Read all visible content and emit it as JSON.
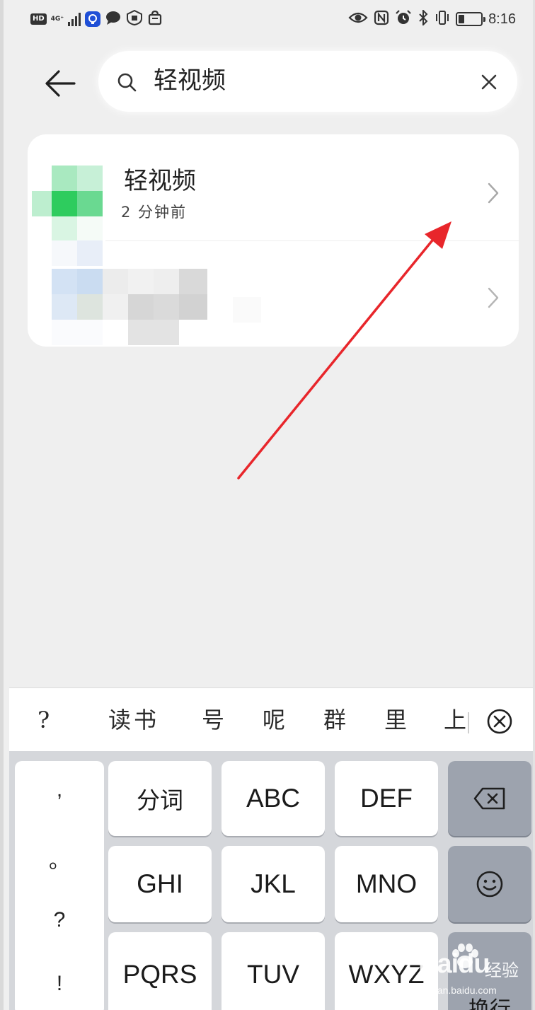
{
  "status_bar": {
    "hd_label": "HD",
    "network_label": "4G⁺",
    "time": "8:16",
    "battery_level_percent": 25,
    "left_icons": [
      "hd-badge-icon",
      "signal-icon",
      "app-notification-icon",
      "chat-icon",
      "shield-icon",
      "bag-icon"
    ],
    "right_icons": [
      "eye-icon",
      "nfc-icon",
      "alarm-icon",
      "bluetooth-icon",
      "vibrate-icon",
      "battery-icon"
    ]
  },
  "search": {
    "query": "轻视频",
    "icons": {
      "back": "back-arrow-icon",
      "search": "search-icon",
      "clear": "close-icon"
    }
  },
  "results": [
    {
      "title": "轻视频",
      "subtitle": "2 分钟前",
      "icon": "app-icon-pixelated",
      "chevron": "chevron-right-icon"
    },
    {
      "title": "",
      "subtitle": "",
      "icon": "app-icon-pixelated",
      "chevron": "chevron-right-icon",
      "blurred": true
    }
  ],
  "candidates": [
    "?",
    "读书",
    "号",
    "呢",
    "群",
    "里",
    "上"
  ],
  "keyboard": {
    "punctuation": [
      ",",
      "。",
      "?",
      "!"
    ],
    "rows": [
      [
        "分词",
        "ABC",
        "DEF"
      ],
      [
        "GHI",
        "JKL",
        "MNO"
      ],
      [
        "PQRS",
        "TUV",
        "WXYZ"
      ]
    ],
    "side_keys": {
      "backspace": "backspace-icon",
      "emoji": "emoji-icon",
      "enter_label": "换行"
    }
  },
  "watermark": {
    "logo": "Baidu",
    "name": "经验",
    "url": "jingyan.baidu.com"
  },
  "colors": {
    "accent_arrow": "#e8262b",
    "app_icon_green": "#2ecc5e",
    "keyboard_bg": "#d5d7db",
    "dark_key": "#9da3ae"
  }
}
